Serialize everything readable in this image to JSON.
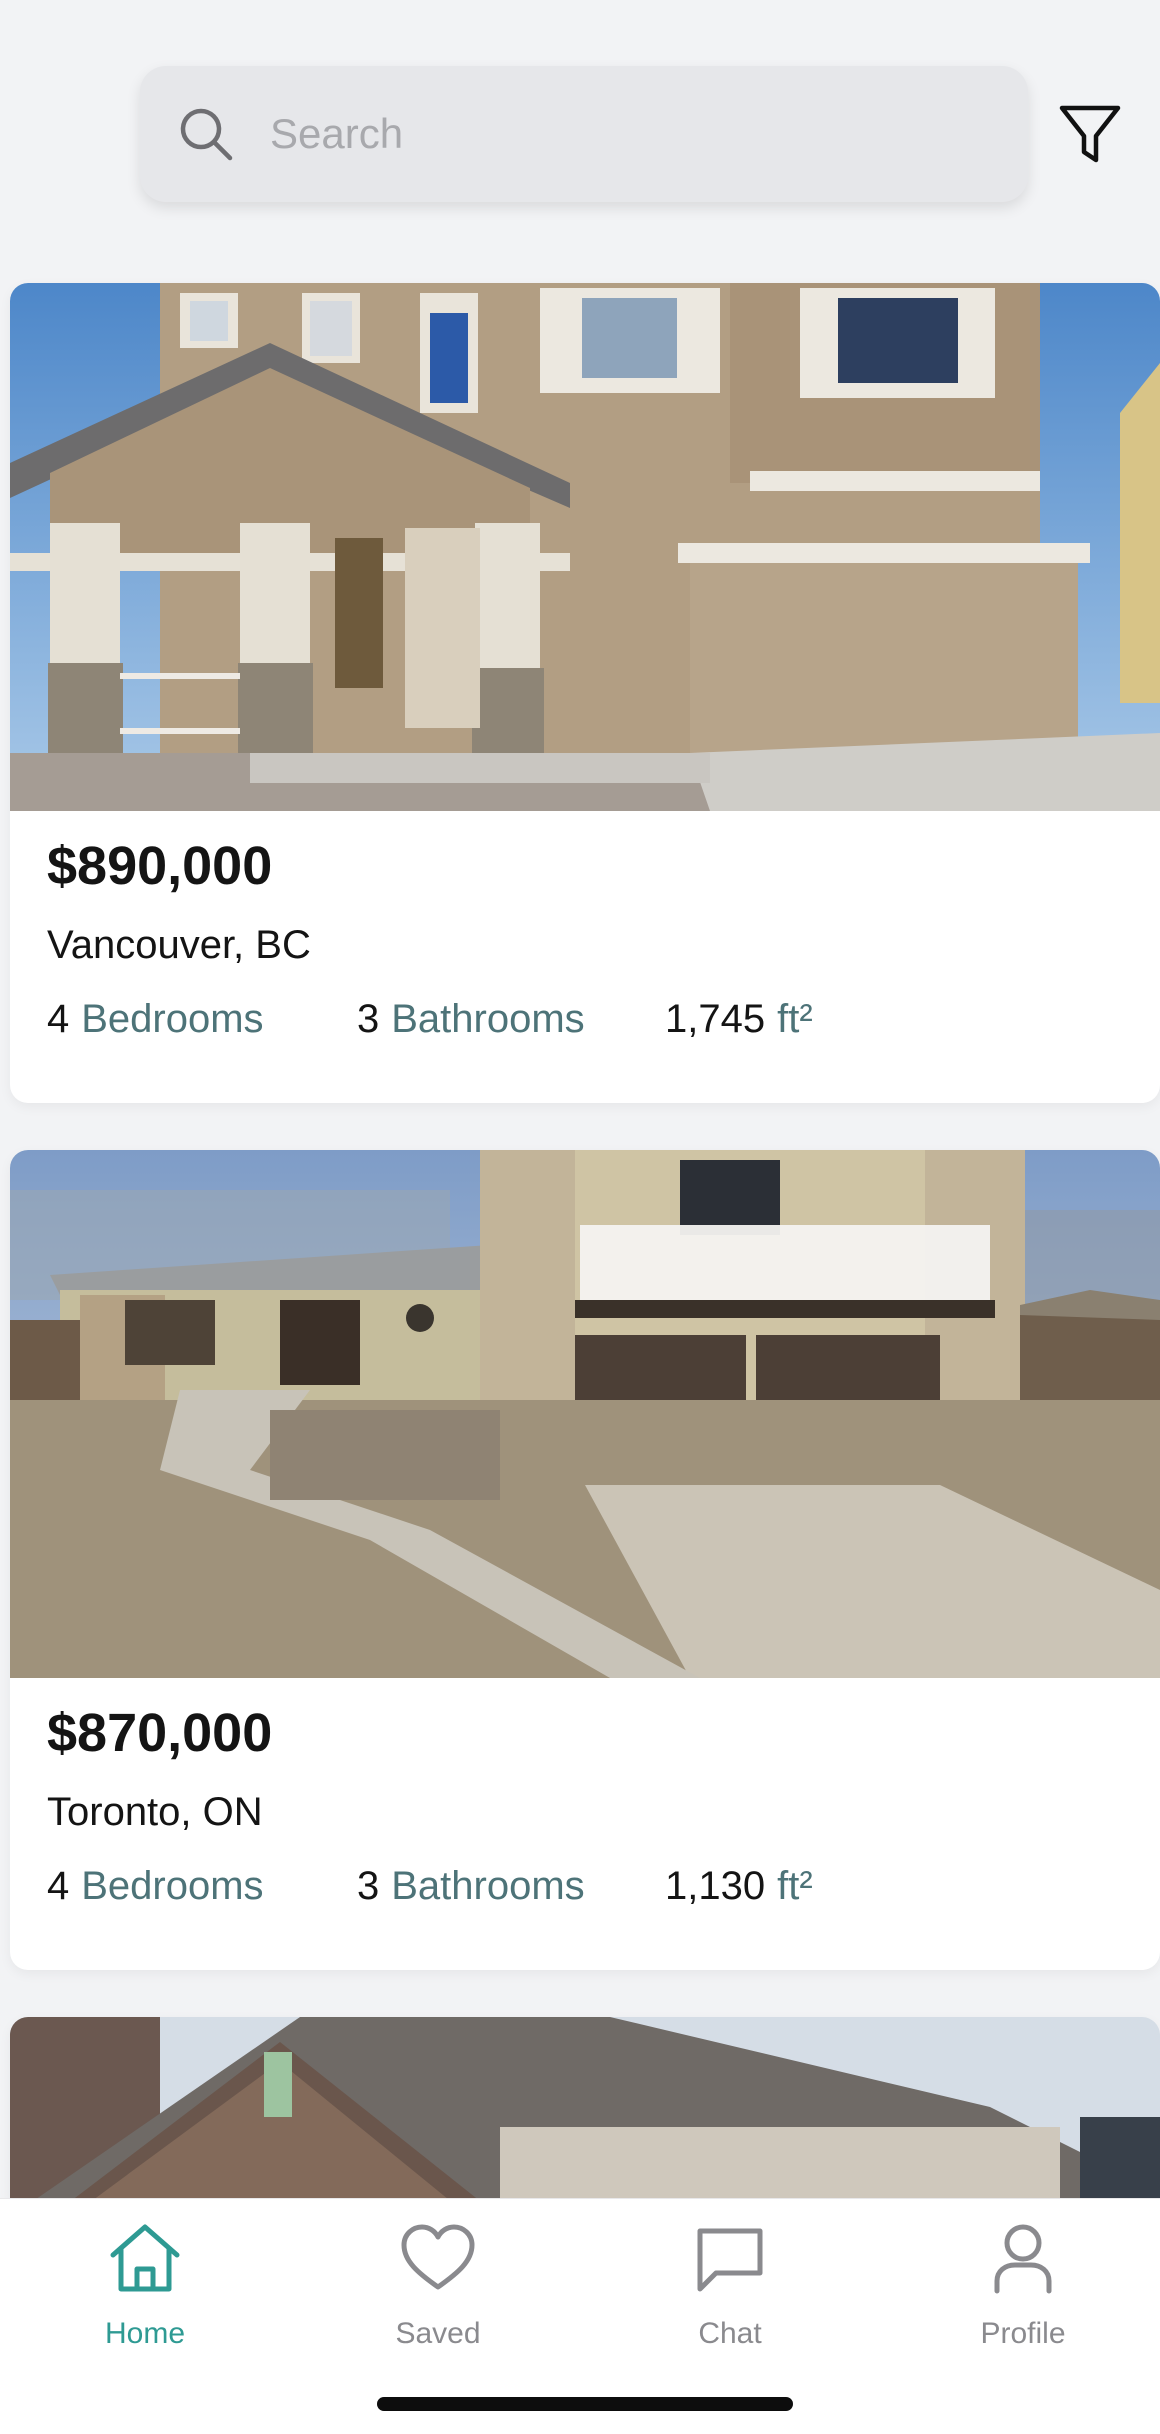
{
  "search": {
    "placeholder": "Search"
  },
  "icons": {
    "search": "search-icon",
    "filter": "filter-icon"
  },
  "listings": [
    {
      "price": "$890,000",
      "location": "Vancouver, BC",
      "bedrooms": "4",
      "bedrooms_label": "Bedrooms",
      "bathrooms": "3",
      "bathrooms_label": "Bathrooms",
      "area": "1,745",
      "area_unit": "ft²"
    },
    {
      "price": "$870,000",
      "location": "Toronto, ON",
      "bedrooms": "4",
      "bedrooms_label": "Bedrooms",
      "bathrooms": "3",
      "bathrooms_label": "Bathrooms",
      "area": "1,130",
      "area_unit": "ft²"
    }
  ],
  "nav": {
    "home": "Home",
    "saved": "Saved",
    "chat": "Chat",
    "profile": "Profile",
    "active": "Home"
  },
  "colors": {
    "accent": "#2e9a93",
    "stat_label": "#4d7378",
    "nav_inactive": "#8a8a8e",
    "background": "#f2f3f5"
  }
}
